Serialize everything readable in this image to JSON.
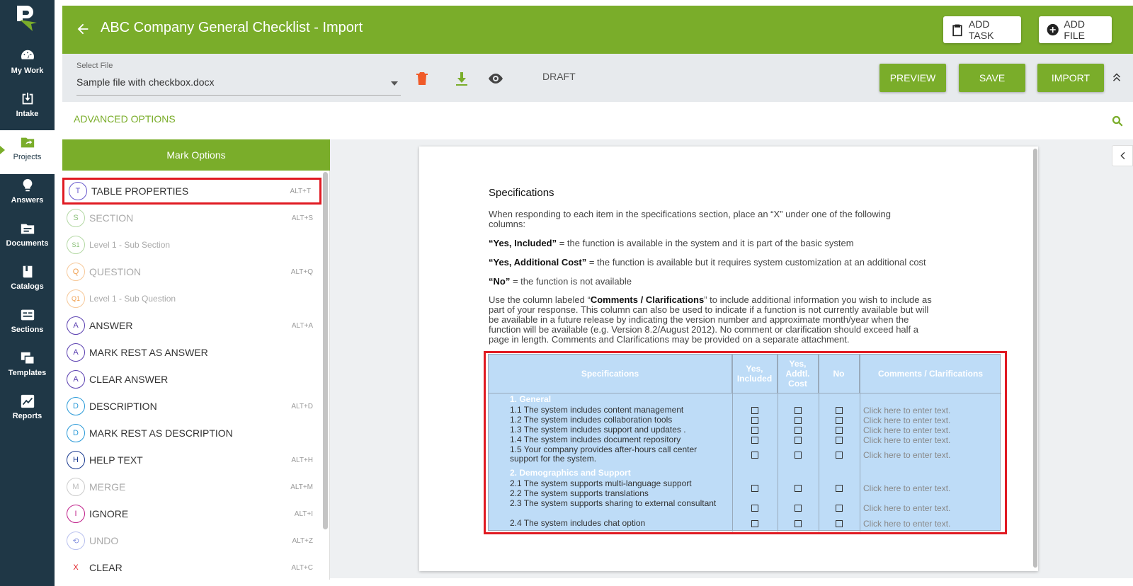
{
  "nav": {
    "items": [
      {
        "label": "My Work",
        "icon": "speedometer-icon"
      },
      {
        "label": "Intake",
        "icon": "inbox-download-icon"
      },
      {
        "label": "Projects",
        "icon": "folder-share-icon"
      },
      {
        "label": "Answers",
        "icon": "lightbulb-icon"
      },
      {
        "label": "Documents",
        "icon": "document-folder-icon"
      },
      {
        "label": "Catalogs",
        "icon": "book-icon"
      },
      {
        "label": "Sections",
        "icon": "sections-icon"
      },
      {
        "label": "Templates",
        "icon": "templates-icon"
      },
      {
        "label": "Reports",
        "icon": "chart-line-icon"
      }
    ]
  },
  "header": {
    "title": "ABC Company General Checklist - Import",
    "add_task": "ADD TASK",
    "add_file": "ADD FILE"
  },
  "toolbar": {
    "select_label": "Select File",
    "select_value": "Sample file with checkbox.docx",
    "status": "DRAFT",
    "preview": "PREVIEW",
    "save": "SAVE",
    "import": "IMPORT"
  },
  "advanced_options": "ADVANCED OPTIONS",
  "mark_options": {
    "title": "Mark Options",
    "items": [
      {
        "letter": "T",
        "label": "TABLE PROPERTIES",
        "key": "ALT+T",
        "color": "#6a5acd"
      },
      {
        "letter": "S",
        "label": "SECTION",
        "key": "ALT+S",
        "color": "#8cc07a"
      },
      {
        "letter": "S1",
        "label": "Level 1 - Sub Section",
        "key": "",
        "color": "#8cc07a"
      },
      {
        "letter": "Q",
        "label": "QUESTION",
        "key": "ALT+Q",
        "color": "#f0a050"
      },
      {
        "letter": "Q1",
        "label": "Level 1 - Sub Question",
        "key": "",
        "color": "#f0a050"
      },
      {
        "letter": "A",
        "label": "ANSWER",
        "key": "ALT+A",
        "color": "#5a3fb0"
      },
      {
        "letter": "A",
        "label": "MARK REST AS ANSWER",
        "key": "",
        "color": "#5a3fb0"
      },
      {
        "letter": "A",
        "label": "CLEAR ANSWER",
        "key": "",
        "color": "#5a3fb0"
      },
      {
        "letter": "D",
        "label": "DESCRIPTION",
        "key": "ALT+D",
        "color": "#2a9ad8"
      },
      {
        "letter": "D",
        "label": "MARK REST AS DESCRIPTION",
        "key": "",
        "color": "#2a9ad8"
      },
      {
        "letter": "H",
        "label": "HELP TEXT",
        "key": "ALT+H",
        "color": "#1a3a90"
      },
      {
        "letter": "M",
        "label": "MERGE",
        "key": "ALT+M",
        "color": "#bbbbbb"
      },
      {
        "letter": "I",
        "label": "IGNORE",
        "key": "ALT+I",
        "color": "#c0208a"
      },
      {
        "letter": "⟲",
        "label": "UNDO",
        "key": "ALT+Z",
        "color": "#5a6ad0"
      },
      {
        "letter": "X",
        "label": "CLEAR",
        "key": "ALT+C",
        "color": "#e01a22"
      }
    ]
  },
  "document": {
    "heading": "Specifications",
    "para1": "When responding to each item in the specifications section, place an “X” under one of the following columns:",
    "yes_included_term": "“Yes, Included”",
    "yes_included_def": " = the function is available in the system and it is part of the basic system",
    "yes_additional_term": "“Yes, Additional Cost”",
    "yes_additional_def": " = the function is available but it requires system customization at an additional cost",
    "no_term": "“No”",
    "no_def": " = the function is not available",
    "para_comments_1": "Use the column labeled “",
    "para_comments_term": "Comments / Clarifications",
    "para_comments_2": "” to include additional information you wish to include as part of your response. This column can also be used to indicate if a function is not currently available but will be available in a future release by indicating the version number and approximate month/year when the function will be available (e.g. Version 8.2/August 2012). No comment or clarification should exceed half a page in length. Comments and Clarifications may be provided on a separate attachment.",
    "table": {
      "headers": [
        "Specifications",
        "Yes, Included",
        "Yes, Addtl. Cost",
        "No",
        "Comments / Clarifications"
      ],
      "group1": "1.  General",
      "group2": "2.  Demographics and Support",
      "rows": [
        {
          "text": "1.1  The system includes content management",
          "comment": "Click here to enter text."
        },
        {
          "text": "1.2  The system includes collaboration tools",
          "comment": "Click here to enter text."
        },
        {
          "text": "1.3  The system includes support and updates .",
          "comment": "Click here to enter text."
        },
        {
          "text": "1.4  The system includes document repository",
          "comment": "Click here to enter text."
        },
        {
          "text": "1.5  Your company provides after-hours call center support for the system.",
          "comment": "Click here to enter text."
        },
        {
          "text": "2.1  The system supports multi-language support",
          "comment": "Click here to enter text."
        },
        {
          "text": "2.2  The system supports translations",
          "comment": "Click here to enter text."
        },
        {
          "text": "2.3  The system supports sharing to external consultant",
          "comment": "Click here to enter text."
        },
        {
          "text": "2.4  The system includes chat option",
          "comment": "Click here to enter text."
        }
      ]
    }
  }
}
